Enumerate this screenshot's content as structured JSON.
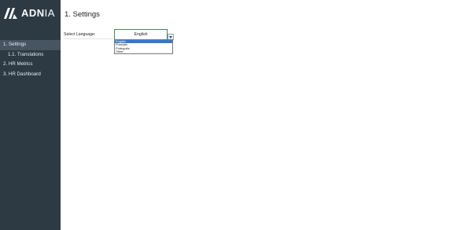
{
  "brand": {
    "name_bold": "ADN",
    "name_thin": "IA"
  },
  "sidebar": {
    "items": [
      {
        "label": "1. Settings",
        "active": true
      },
      {
        "label": "1.1. Translations",
        "active": false
      },
      {
        "label": "2. HR Metrics",
        "active": false
      },
      {
        "label": "3. HR Dashboard",
        "active": false
      }
    ]
  },
  "page": {
    "title": "1. Settings"
  },
  "language": {
    "label": "Select Language:",
    "selected": "English",
    "options": [
      "English",
      "Français",
      "Português",
      "Other"
    ]
  },
  "colors": {
    "sidebar_bg": "#2d3a44",
    "sidebar_active": "#465561",
    "select_border": "#3b8b5a",
    "option_highlight": "#2f7ad6"
  }
}
